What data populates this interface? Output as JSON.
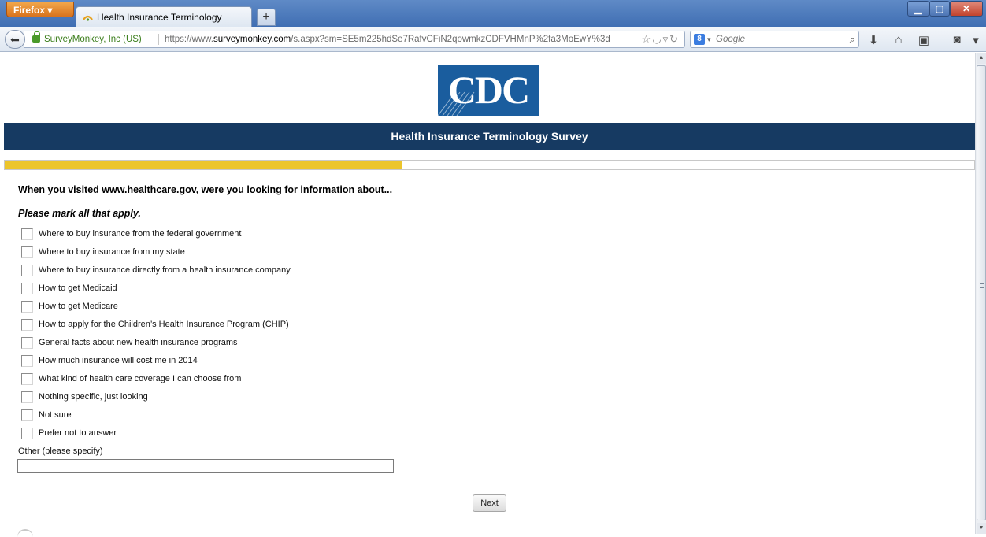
{
  "browser": {
    "menu_button_label": "Firefox",
    "tab_title": "Health Insurance Terminology Survey",
    "new_tab_label": "+",
    "identity": "SurveyMonkey, Inc (US)",
    "url_prefix": "https://www.",
    "url_domain": "surveymonkey.com",
    "url_suffix": "/s.aspx?sm=SE5m225hdSe7RafvCFiN2qowmkzCDFVHMnP%2fa3MoEwY%3d",
    "search_engine_label": "Google",
    "icons": [
      "back-icon",
      "lock-icon",
      "bookmark-star-icon",
      "reader-icon",
      "dropdown-icon",
      "reload-icon",
      "google-icon",
      "search-icon",
      "download-icon",
      "home-icon",
      "bookmarks-icon",
      "pocket-icon",
      "menu-icon"
    ]
  },
  "survey": {
    "logo_text": "CDC",
    "title": "Health Insurance Terminology Survey",
    "progress": 0.41,
    "accent_color": "#ecc52c",
    "banner_color": "#163a62",
    "question": "When you visited www.healthcare.gov, were you looking for information about...",
    "instruction": "Please mark all that apply.",
    "options": [
      "Where to buy insurance from the federal government",
      "Where to buy insurance from my state",
      "Where to buy insurance directly from a health insurance company",
      "How to get Medicaid",
      "How to get Medicare",
      "How to apply for the Children’s Health Insurance Program (CHIP)",
      "General facts about new health insurance programs",
      "How much insurance will cost me in 2014",
      "What kind of health care coverage I can choose from",
      "Nothing specific, just looking",
      "Not sure",
      "Prefer not to answer"
    ],
    "other_label": "Other (please specify)",
    "other_value": "",
    "next_label": "Next"
  }
}
